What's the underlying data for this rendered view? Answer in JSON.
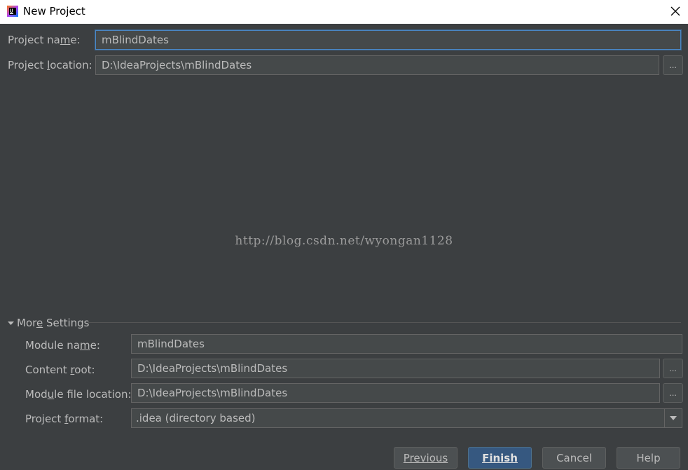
{
  "window": {
    "title": "New Project",
    "icon": "intellij-idea-icon",
    "close_icon": "close-icon"
  },
  "project": {
    "name_label": "Project name:",
    "name_value": "mBlindDates",
    "location_label": "Project location:",
    "location_value": "D:\\IdeaProjects\\mBlindDates",
    "browse_label": "..."
  },
  "watermark": "http://blog.csdn.net/wyongan1128",
  "more_settings": {
    "header": "More Settings",
    "expanded": true,
    "module_name_label": "Module name:",
    "module_name_value": "mBlindDates",
    "content_root_label": "Content root:",
    "content_root_value": "D:\\IdeaProjects\\mBlindDates",
    "module_file_label": "Module file location:",
    "module_file_value": "D:\\IdeaProjects\\mBlindDates",
    "project_format_label": "Project format:",
    "project_format_value": ".idea (directory based)",
    "browse_label": "..."
  },
  "buttons": {
    "previous": "Previous",
    "finish": "Finish",
    "cancel": "Cancel",
    "help": "Help"
  },
  "colors": {
    "background": "#3c3f41",
    "field": "#45494a",
    "default_button": "#365880",
    "focus_border": "#4a88c7"
  }
}
